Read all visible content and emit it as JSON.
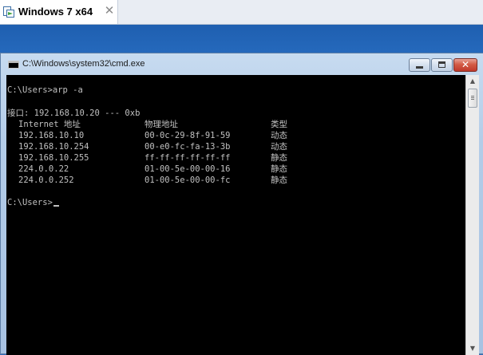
{
  "vm_tab": {
    "label": "Windows 7 x64",
    "close_glyph": "✕",
    "icon": "vm-icon"
  },
  "cmd_window": {
    "title": "C:\\Windows\\system32\\cmd.exe",
    "buttons": {
      "minimize": "minimize-icon",
      "maximize": "maximize-icon",
      "close": "✕"
    }
  },
  "console": {
    "prompt_cmd": "C:\\Users>arp -a",
    "interface_line": "接口: 192.168.10.20 --- 0xb",
    "columns": [
      "Internet 地址",
      "物理地址",
      "类型"
    ],
    "rows": [
      [
        "192.168.10.10",
        "00-0c-29-8f-91-59",
        "动态"
      ],
      [
        "192.168.10.254",
        "00-e0-fc-fa-13-3b",
        "动态"
      ],
      [
        "192.168.10.255",
        "ff-ff-ff-ff-ff-ff",
        "静态"
      ],
      [
        "224.0.0.22",
        "01-00-5e-00-00-16",
        "静态"
      ],
      [
        "224.0.0.252",
        "01-00-5e-00-00-fc",
        "静态"
      ]
    ],
    "final_prompt": "C:\\Users>"
  },
  "colors": {
    "console_bg": "#000000",
    "console_text": "#c0c0c0",
    "desktop": "#2f6db9"
  }
}
